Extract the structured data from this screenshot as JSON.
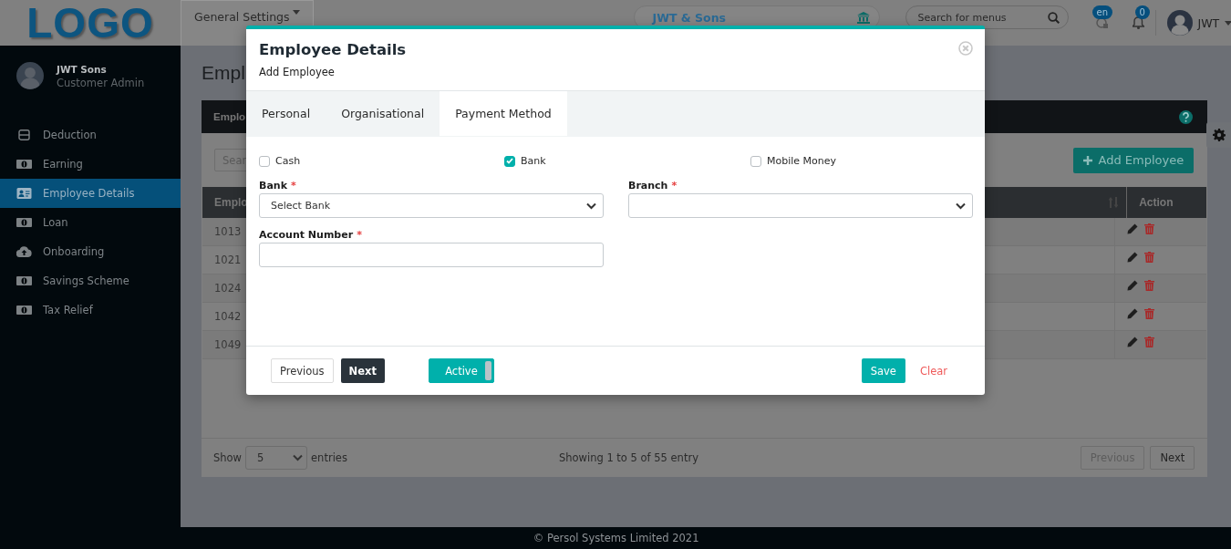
{
  "topbar": {
    "logo": "LOGO",
    "menu": "General Settings",
    "company": "JWT & Sons",
    "search": {
      "placeholder": "Search for menus"
    },
    "language_badge": "en",
    "notification_count": "0",
    "user": "JWT"
  },
  "sidebar": {
    "user_name": "JWT Sons",
    "user_role": "Customer Admin",
    "items": [
      {
        "label": "Deduction",
        "kind": "box",
        "selected": false
      },
      {
        "label": "Earning",
        "kind": "money",
        "selected": false
      },
      {
        "label": "Employee Details",
        "kind": "card",
        "selected": true
      },
      {
        "label": "Loan",
        "kind": "money",
        "selected": false
      },
      {
        "label": "Onboarding",
        "kind": "cloud",
        "selected": false
      },
      {
        "label": "Savings Scheme",
        "kind": "money",
        "selected": false
      },
      {
        "label": "Tax Relief",
        "kind": "money",
        "selected": false
      }
    ]
  },
  "page": {
    "title": "Empl",
    "card_title": "Emplo",
    "search": {
      "placeholder": "Sear"
    },
    "add_button": "Add Employee",
    "columns": [
      "Emplo",
      "Action"
    ],
    "rows": [
      {
        "id": "1013"
      },
      {
        "id": "1021"
      },
      {
        "id": "1024"
      },
      {
        "id": "1042"
      },
      {
        "id": "1049"
      }
    ],
    "show_label": "Show",
    "page_size": "5",
    "entries_label": "entries",
    "summary": "Showing 1 to 5 of 55 entry",
    "pagination": [
      {
        "label": "Previous",
        "disabled": true
      },
      {
        "label": "Next",
        "disabled": false
      }
    ]
  },
  "modal": {
    "title": "Employee Details",
    "subtitle": "Add Employee",
    "tabs": [
      {
        "label": "Personal",
        "selected": false
      },
      {
        "label": "Organisational",
        "selected": false
      },
      {
        "label": "Payment Method",
        "selected": true
      }
    ],
    "methods": [
      {
        "label": "Cash",
        "checked": false
      },
      {
        "label": "Bank",
        "checked": true
      },
      {
        "label": "Mobile Money",
        "checked": false
      }
    ],
    "required_mark": "*",
    "fields": [
      {
        "label": "Bank",
        "required": true,
        "kind": "select",
        "value": "Select Bank"
      },
      {
        "label": "Branch",
        "required": true,
        "kind": "select"
      },
      {
        "label": "Account Number",
        "required": true,
        "kind": "text"
      }
    ],
    "previous": "Previous",
    "next": "Next",
    "status": {
      "label": "Active",
      "on": true
    },
    "save": "Save",
    "clear": "Clear"
  },
  "footer": "© Persol Systems Limited 2021"
}
